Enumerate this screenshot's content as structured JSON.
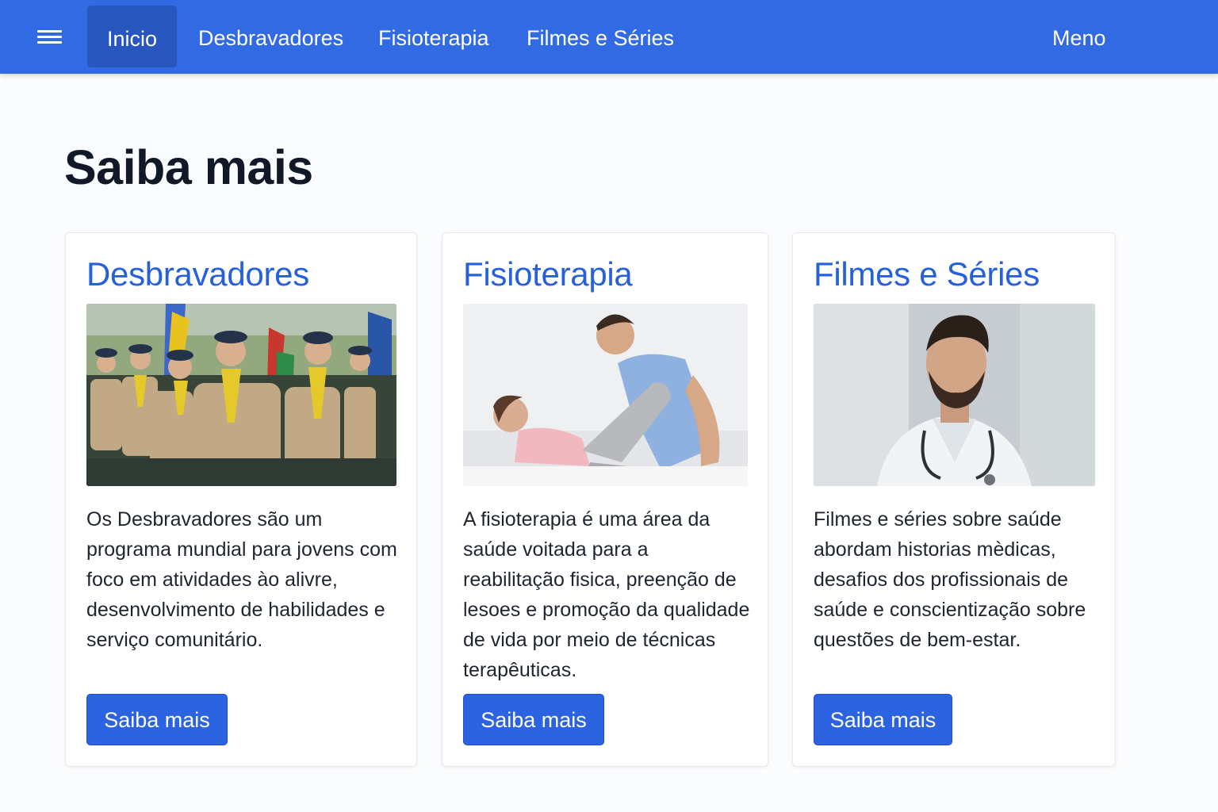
{
  "nav": {
    "items": [
      {
        "label": "Inicio",
        "active": true
      },
      {
        "label": "Desbravadores",
        "active": false
      },
      {
        "label": "Fisioterapia",
        "active": false
      },
      {
        "label": "Filmes e Séries",
        "active": false
      }
    ],
    "right_label": "Meno",
    "menu_icon": "hamburger-icon"
  },
  "main": {
    "title": "Saiba mais"
  },
  "cards": [
    {
      "title": "Desbravadores",
      "text": "Os Desbravadores são um programa mundial para jovens com foco em atividades ào alivre, desenvolvimento de habilidades e serviço comunitário.",
      "button": "Saiba mais",
      "image": "pathfinders-group-photo"
    },
    {
      "title": "Fisioterapia",
      "text": "A fisioterapia é uma área da saúde voitada para a reabilitação fisica, preenção de lesoes e promoção da qualidade de vida por meio de técnicas terapêuticas.",
      "button": "Saiba mais",
      "image": "physiotherapy-session-photo"
    },
    {
      "title": "Filmes e Séries",
      "text": "Filmes e séries sobre saúde abordam historias mèdicas, desafios dos profissionais de saúde e conscientização sobre questões de bem-estar.",
      "button": "Saiba mais",
      "image": "doctor-portrait-photo"
    }
  ],
  "colors": {
    "primary": "#316ae2",
    "active_nav": "#2856bf",
    "card_title": "#2660db",
    "button": "#2c63e0"
  }
}
